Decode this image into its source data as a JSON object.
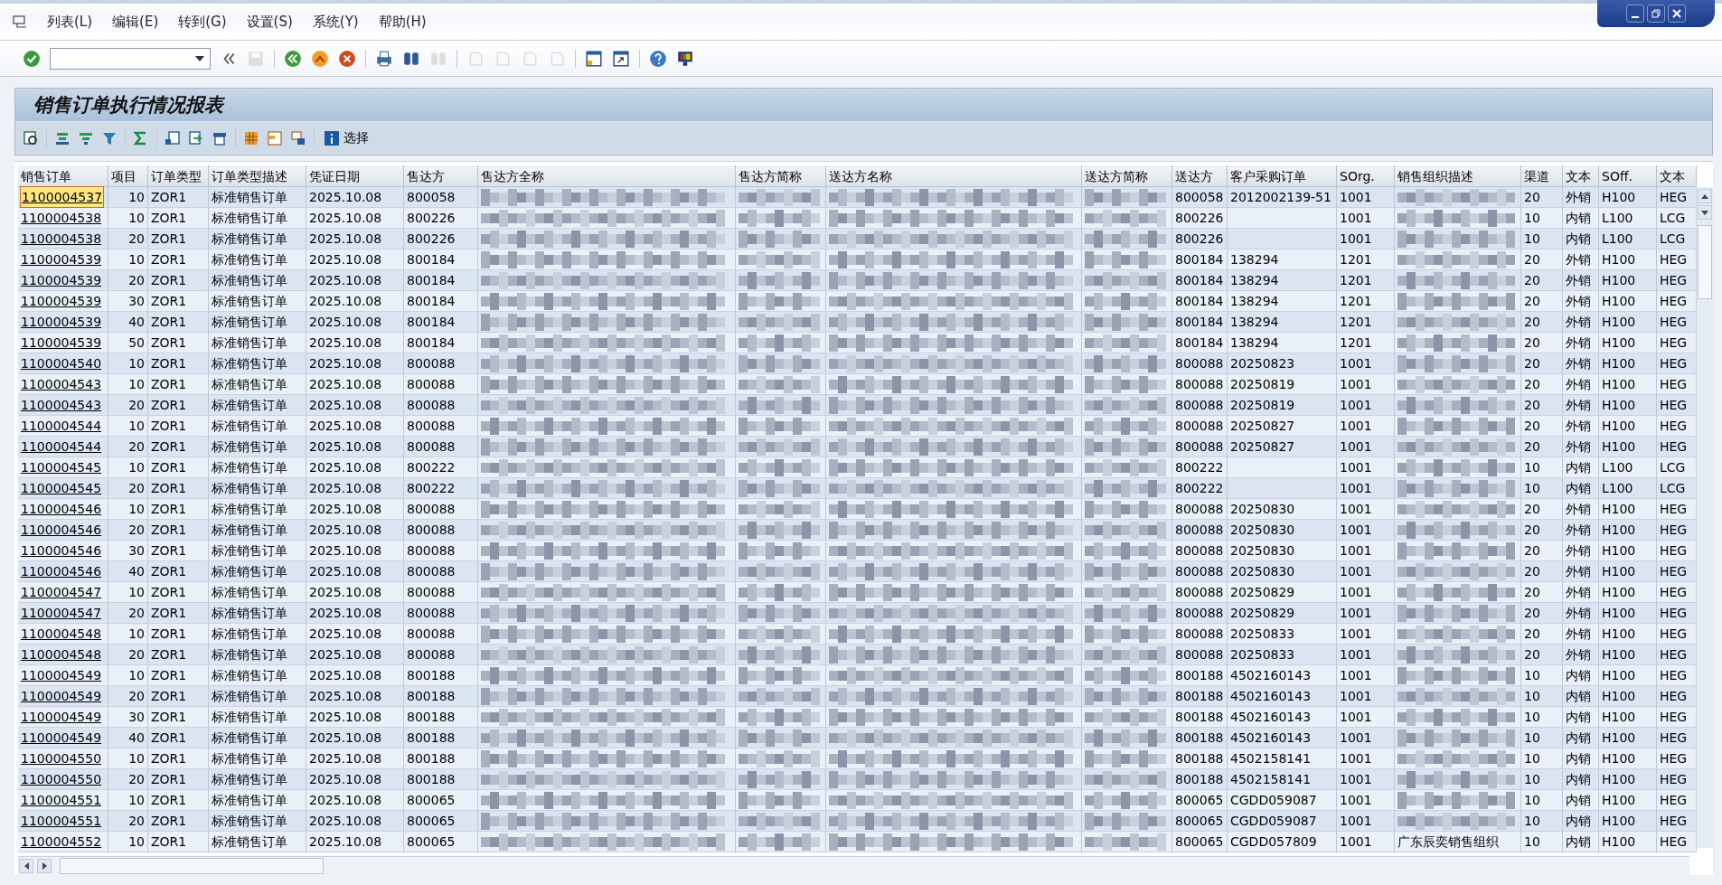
{
  "menu": [
    {
      "label": "列表(L)"
    },
    {
      "label": "编辑(E)"
    },
    {
      "label": "转到(G)"
    },
    {
      "label": "设置(S)"
    },
    {
      "label": "系统(Y)"
    },
    {
      "label": "帮助(H)"
    }
  ],
  "toolbar": [
    {
      "kind": "check",
      "disabled": false
    },
    {
      "kind": "command-field"
    },
    {
      "kind": "collapse",
      "disabled": false
    },
    {
      "kind": "save",
      "disabled": true
    },
    {
      "kind": "sep"
    },
    {
      "kind": "back",
      "disabled": false
    },
    {
      "kind": "exit",
      "disabled": false
    },
    {
      "kind": "cancel",
      "disabled": false
    },
    {
      "kind": "sep"
    },
    {
      "kind": "print",
      "disabled": false
    },
    {
      "kind": "find",
      "disabled": false
    },
    {
      "kind": "find-next",
      "disabled": true
    },
    {
      "kind": "sep"
    },
    {
      "kind": "first-page",
      "disabled": true
    },
    {
      "kind": "prev-page",
      "disabled": true
    },
    {
      "kind": "next-page",
      "disabled": true
    },
    {
      "kind": "last-page",
      "disabled": true
    },
    {
      "kind": "sep"
    },
    {
      "kind": "new-window",
      "disabled": false
    },
    {
      "kind": "shortcut",
      "disabled": false
    },
    {
      "kind": "sep"
    },
    {
      "kind": "help",
      "disabled": false
    },
    {
      "kind": "monitor",
      "disabled": false
    }
  ],
  "title": "销售订单执行情况报表",
  "alv_toolbar": [
    {
      "kind": "details"
    },
    {
      "kind": "sep"
    },
    {
      "kind": "sort-asc"
    },
    {
      "kind": "sort-desc"
    },
    {
      "kind": "filter"
    },
    {
      "kind": "sep"
    },
    {
      "kind": "sum"
    },
    {
      "kind": "sep"
    },
    {
      "kind": "export"
    },
    {
      "kind": "send"
    },
    {
      "kind": "print"
    },
    {
      "kind": "sep"
    },
    {
      "kind": "grid"
    },
    {
      "kind": "columns"
    },
    {
      "kind": "layout"
    },
    {
      "kind": "sep"
    },
    {
      "kind": "info",
      "label": "选择"
    }
  ],
  "table": {
    "columns": [
      "销售订单",
      "项目",
      "订单类型",
      "订单类型描述",
      "凭证日期",
      "售达方",
      "售达方全称",
      "售达方简称",
      "送达方名称",
      "送达方简称",
      "送达方",
      "客户采购订单",
      "SOrg.",
      "销售组织描述",
      "渠道",
      "文本",
      "SOff.",
      "文本"
    ],
    "rows": [
      {
        "focused": true,
        "cells": [
          "1100004537",
          "10",
          "ZOR1",
          "标准销售订单",
          "2025.10.08",
          "800058",
          {
            "kind": "blurred"
          },
          {
            "kind": "blurred"
          },
          {
            "kind": "blurred"
          },
          {
            "kind": "blurred"
          },
          "800058",
          "2012002139-51",
          "1001",
          {
            "kind": "blurred"
          },
          "20",
          "外销",
          "H100",
          "HEG"
        ]
      },
      {
        "focused": false,
        "cells": [
          "1100004538",
          "10",
          "ZOR1",
          "标准销售订单",
          "2025.10.08",
          "800226",
          {
            "kind": "blurred"
          },
          {
            "kind": "blurred"
          },
          {
            "kind": "blurred"
          },
          {
            "kind": "blurred"
          },
          "800226",
          null,
          "1001",
          {
            "kind": "blurred"
          },
          "10",
          "内销",
          "L100",
          "LCG"
        ]
      },
      {
        "focused": false,
        "cells": [
          "1100004538",
          "20",
          "ZOR1",
          "标准销售订单",
          "2025.10.08",
          "800226",
          {
            "kind": "blurred"
          },
          {
            "kind": "blurred"
          },
          {
            "kind": "blurred"
          },
          {
            "kind": "blurred"
          },
          "800226",
          null,
          "1001",
          {
            "kind": "blurred"
          },
          "10",
          "内销",
          "L100",
          "LCG"
        ]
      },
      {
        "focused": false,
        "cells": [
          "1100004539",
          "10",
          "ZOR1",
          "标准销售订单",
          "2025.10.08",
          "800184",
          {
            "kind": "blurred"
          },
          {
            "kind": "blurred"
          },
          {
            "kind": "blurred"
          },
          {
            "kind": "blurred"
          },
          "800184",
          "138294",
          "1201",
          {
            "kind": "blurred"
          },
          "20",
          "外销",
          "H100",
          "HEG"
        ]
      },
      {
        "focused": false,
        "cells": [
          "1100004539",
          "20",
          "ZOR1",
          "标准销售订单",
          "2025.10.08",
          "800184",
          {
            "kind": "blurred"
          },
          {
            "kind": "blurred"
          },
          {
            "kind": "blurred"
          },
          {
            "kind": "blurred"
          },
          "800184",
          "138294",
          "1201",
          {
            "kind": "blurred"
          },
          "20",
          "外销",
          "H100",
          "HEG"
        ]
      },
      {
        "focused": false,
        "cells": [
          "1100004539",
          "30",
          "ZOR1",
          "标准销售订单",
          "2025.10.08",
          "800184",
          {
            "kind": "blurred"
          },
          {
            "kind": "blurred"
          },
          {
            "kind": "blurred"
          },
          {
            "kind": "blurred"
          },
          "800184",
          "138294",
          "1201",
          {
            "kind": "blurred"
          },
          "20",
          "外销",
          "H100",
          "HEG"
        ]
      },
      {
        "focused": false,
        "cells": [
          "1100004539",
          "40",
          "ZOR1",
          "标准销售订单",
          "2025.10.08",
          "800184",
          {
            "kind": "blurred"
          },
          {
            "kind": "blurred"
          },
          {
            "kind": "blurred"
          },
          {
            "kind": "blurred"
          },
          "800184",
          "138294",
          "1201",
          {
            "kind": "blurred"
          },
          "20",
          "外销",
          "H100",
          "HEG"
        ]
      },
      {
        "focused": false,
        "cells": [
          "1100004539",
          "50",
          "ZOR1",
          "标准销售订单",
          "2025.10.08",
          "800184",
          {
            "kind": "blurred"
          },
          {
            "kind": "blurred"
          },
          {
            "kind": "blurred"
          },
          {
            "kind": "blurred"
          },
          "800184",
          "138294",
          "1201",
          {
            "kind": "blurred"
          },
          "20",
          "外销",
          "H100",
          "HEG"
        ]
      },
      {
        "focused": false,
        "cells": [
          "1100004540",
          "10",
          "ZOR1",
          "标准销售订单",
          "2025.10.08",
          "800088",
          {
            "kind": "blurred"
          },
          {
            "kind": "blurred"
          },
          {
            "kind": "blurred"
          },
          {
            "kind": "blurred"
          },
          "800088",
          "20250823",
          "1001",
          {
            "kind": "blurred"
          },
          "20",
          "外销",
          "H100",
          "HEG"
        ]
      },
      {
        "focused": false,
        "cells": [
          "1100004543",
          "10",
          "ZOR1",
          "标准销售订单",
          "2025.10.08",
          "800088",
          {
            "kind": "blurred"
          },
          {
            "kind": "blurred"
          },
          {
            "kind": "blurred"
          },
          {
            "kind": "blurred"
          },
          "800088",
          "20250819",
          "1001",
          {
            "kind": "blurred"
          },
          "20",
          "外销",
          "H100",
          "HEG"
        ]
      },
      {
        "focused": false,
        "cells": [
          "1100004543",
          "20",
          "ZOR1",
          "标准销售订单",
          "2025.10.08",
          "800088",
          {
            "kind": "blurred"
          },
          {
            "kind": "blurred"
          },
          {
            "kind": "blurred"
          },
          {
            "kind": "blurred"
          },
          "800088",
          "20250819",
          "1001",
          {
            "kind": "blurred"
          },
          "20",
          "外销",
          "H100",
          "HEG"
        ]
      },
      {
        "focused": false,
        "cells": [
          "1100004544",
          "10",
          "ZOR1",
          "标准销售订单",
          "2025.10.08",
          "800088",
          {
            "kind": "blurred"
          },
          {
            "kind": "blurred"
          },
          {
            "kind": "blurred"
          },
          {
            "kind": "blurred"
          },
          "800088",
          "20250827",
          "1001",
          {
            "kind": "blurred"
          },
          "20",
          "外销",
          "H100",
          "HEG"
        ]
      },
      {
        "focused": false,
        "cells": [
          "1100004544",
          "20",
          "ZOR1",
          "标准销售订单",
          "2025.10.08",
          "800088",
          {
            "kind": "blurred"
          },
          {
            "kind": "blurred"
          },
          {
            "kind": "blurred"
          },
          {
            "kind": "blurred"
          },
          "800088",
          "20250827",
          "1001",
          {
            "kind": "blurred"
          },
          "20",
          "外销",
          "H100",
          "HEG"
        ]
      },
      {
        "focused": false,
        "cells": [
          "1100004545",
          "10",
          "ZOR1",
          "标准销售订单",
          "2025.10.08",
          "800222",
          {
            "kind": "blurred"
          },
          {
            "kind": "blurred"
          },
          {
            "kind": "blurred"
          },
          {
            "kind": "blurred"
          },
          "800222",
          null,
          "1001",
          {
            "kind": "blurred"
          },
          "10",
          "内销",
          "L100",
          "LCG"
        ]
      },
      {
        "focused": false,
        "cells": [
          "1100004545",
          "20",
          "ZOR1",
          "标准销售订单",
          "2025.10.08",
          "800222",
          {
            "kind": "blurred"
          },
          {
            "kind": "blurred"
          },
          {
            "kind": "blurred"
          },
          {
            "kind": "blurred"
          },
          "800222",
          null,
          "1001",
          {
            "kind": "blurred"
          },
          "10",
          "内销",
          "L100",
          "LCG"
        ]
      },
      {
        "focused": false,
        "cells": [
          "1100004546",
          "10",
          "ZOR1",
          "标准销售订单",
          "2025.10.08",
          "800088",
          {
            "kind": "blurred"
          },
          {
            "kind": "blurred"
          },
          {
            "kind": "blurred"
          },
          {
            "kind": "blurred"
          },
          "800088",
          "20250830",
          "1001",
          {
            "kind": "blurred"
          },
          "20",
          "外销",
          "H100",
          "HEG"
        ]
      },
      {
        "focused": false,
        "cells": [
          "1100004546",
          "20",
          "ZOR1",
          "标准销售订单",
          "2025.10.08",
          "800088",
          {
            "kind": "blurred"
          },
          {
            "kind": "blurred"
          },
          {
            "kind": "blurred"
          },
          {
            "kind": "blurred"
          },
          "800088",
          "20250830",
          "1001",
          {
            "kind": "blurred"
          },
          "20",
          "外销",
          "H100",
          "HEG"
        ]
      },
      {
        "focused": false,
        "cells": [
          "1100004546",
          "30",
          "ZOR1",
          "标准销售订单",
          "2025.10.08",
          "800088",
          {
            "kind": "blurred"
          },
          {
            "kind": "blurred"
          },
          {
            "kind": "blurred"
          },
          {
            "kind": "blurred"
          },
          "800088",
          "20250830",
          "1001",
          {
            "kind": "blurred"
          },
          "20",
          "外销",
          "H100",
          "HEG"
        ]
      },
      {
        "focused": false,
        "cells": [
          "1100004546",
          "40",
          "ZOR1",
          "标准销售订单",
          "2025.10.08",
          "800088",
          {
            "kind": "blurred"
          },
          {
            "kind": "blurred"
          },
          {
            "kind": "blurred"
          },
          {
            "kind": "blurred"
          },
          "800088",
          "20250830",
          "1001",
          {
            "kind": "blurred"
          },
          "20",
          "外销",
          "H100",
          "HEG"
        ]
      },
      {
        "focused": false,
        "cells": [
          "1100004547",
          "10",
          "ZOR1",
          "标准销售订单",
          "2025.10.08",
          "800088",
          {
            "kind": "blurred"
          },
          {
            "kind": "blurred"
          },
          {
            "kind": "blurred"
          },
          {
            "kind": "blurred"
          },
          "800088",
          "20250829",
          "1001",
          {
            "kind": "blurred"
          },
          "20",
          "外销",
          "H100",
          "HEG"
        ]
      },
      {
        "focused": false,
        "cells": [
          "1100004547",
          "20",
          "ZOR1",
          "标准销售订单",
          "2025.10.08",
          "800088",
          {
            "kind": "blurred"
          },
          {
            "kind": "blurred"
          },
          {
            "kind": "blurred"
          },
          {
            "kind": "blurred"
          },
          "800088",
          "20250829",
          "1001",
          {
            "kind": "blurred"
          },
          "20",
          "外销",
          "H100",
          "HEG"
        ]
      },
      {
        "focused": false,
        "cells": [
          "1100004548",
          "10",
          "ZOR1",
          "标准销售订单",
          "2025.10.08",
          "800088",
          {
            "kind": "blurred"
          },
          {
            "kind": "blurred"
          },
          {
            "kind": "blurred"
          },
          {
            "kind": "blurred"
          },
          "800088",
          "20250833",
          "1001",
          {
            "kind": "blurred"
          },
          "20",
          "外销",
          "H100",
          "HEG"
        ]
      },
      {
        "focused": false,
        "cells": [
          "1100004548",
          "20",
          "ZOR1",
          "标准销售订单",
          "2025.10.08",
          "800088",
          {
            "kind": "blurred"
          },
          {
            "kind": "blurred"
          },
          {
            "kind": "blurred"
          },
          {
            "kind": "blurred"
          },
          "800088",
          "20250833",
          "1001",
          {
            "kind": "blurred"
          },
          "20",
          "外销",
          "H100",
          "HEG"
        ]
      },
      {
        "focused": false,
        "cells": [
          "1100004549",
          "10",
          "ZOR1",
          "标准销售订单",
          "2025.10.08",
          "800188",
          {
            "kind": "blurred"
          },
          {
            "kind": "blurred"
          },
          {
            "kind": "blurred"
          },
          {
            "kind": "blurred"
          },
          "800188",
          "4502160143",
          "1001",
          {
            "kind": "blurred"
          },
          "10",
          "内销",
          "H100",
          "HEG"
        ]
      },
      {
        "focused": false,
        "cells": [
          "1100004549",
          "20",
          "ZOR1",
          "标准销售订单",
          "2025.10.08",
          "800188",
          {
            "kind": "blurred"
          },
          {
            "kind": "blurred"
          },
          {
            "kind": "blurred"
          },
          {
            "kind": "blurred"
          },
          "800188",
          "4502160143",
          "1001",
          {
            "kind": "blurred"
          },
          "10",
          "内销",
          "H100",
          "HEG"
        ]
      },
      {
        "focused": false,
        "cells": [
          "1100004549",
          "30",
          "ZOR1",
          "标准销售订单",
          "2025.10.08",
          "800188",
          {
            "kind": "blurred"
          },
          {
            "kind": "blurred"
          },
          {
            "kind": "blurred"
          },
          {
            "kind": "blurred"
          },
          "800188",
          "4502160143",
          "1001",
          {
            "kind": "blurred"
          },
          "10",
          "内销",
          "H100",
          "HEG"
        ]
      },
      {
        "focused": false,
        "cells": [
          "1100004549",
          "40",
          "ZOR1",
          "标准销售订单",
          "2025.10.08",
          "800188",
          {
            "kind": "blurred"
          },
          {
            "kind": "blurred"
          },
          {
            "kind": "blurred"
          },
          {
            "kind": "blurred"
          },
          "800188",
          "4502160143",
          "1001",
          {
            "kind": "blurred"
          },
          "10",
          "内销",
          "H100",
          "HEG"
        ]
      },
      {
        "focused": false,
        "cells": [
          "1100004550",
          "10",
          "ZOR1",
          "标准销售订单",
          "2025.10.08",
          "800188",
          {
            "kind": "blurred"
          },
          {
            "kind": "blurred"
          },
          {
            "kind": "blurred"
          },
          {
            "kind": "blurred"
          },
          "800188",
          "4502158141",
          "1001",
          {
            "kind": "blurred"
          },
          "10",
          "内销",
          "H100",
          "HEG"
        ]
      },
      {
        "focused": false,
        "cells": [
          "1100004550",
          "20",
          "ZOR1",
          "标准销售订单",
          "2025.10.08",
          "800188",
          {
            "kind": "blurred"
          },
          {
            "kind": "blurred"
          },
          {
            "kind": "blurred"
          },
          {
            "kind": "blurred"
          },
          "800188",
          "4502158141",
          "1001",
          {
            "kind": "blurred"
          },
          "10",
          "内销",
          "H100",
          "HEG"
        ]
      },
      {
        "focused": false,
        "cells": [
          "1100004551",
          "10",
          "ZOR1",
          "标准销售订单",
          "2025.10.08",
          "800065",
          {
            "kind": "blurred"
          },
          {
            "kind": "blurred"
          },
          {
            "kind": "blurred"
          },
          {
            "kind": "blurred"
          },
          "800065",
          "CGDD059087",
          "1001",
          {
            "kind": "blurred"
          },
          "10",
          "内销",
          "H100",
          "HEG"
        ]
      },
      {
        "focused": false,
        "cells": [
          "1100004551",
          "20",
          "ZOR1",
          "标准销售订单",
          "2025.10.08",
          "800065",
          {
            "kind": "blurred"
          },
          {
            "kind": "blurred"
          },
          {
            "kind": "blurred"
          },
          {
            "kind": "blurred"
          },
          "800065",
          "CGDD059087",
          "1001",
          {
            "kind": "blurred"
          },
          "10",
          "内销",
          "H100",
          "HEG"
        ]
      },
      {
        "focused": false,
        "cells": [
          "1100004552",
          "10",
          "ZOR1",
          "标准销售订单",
          "2025.10.08",
          "800065",
          {
            "kind": "blurred"
          },
          {
            "kind": "blurred"
          },
          {
            "kind": "blurred"
          },
          {
            "kind": "blurred"
          },
          "800065",
          "CGDD057809",
          "1001",
          "广东辰奕销售组织",
          "10",
          "内销",
          "H100",
          "HEG"
        ]
      }
    ]
  }
}
